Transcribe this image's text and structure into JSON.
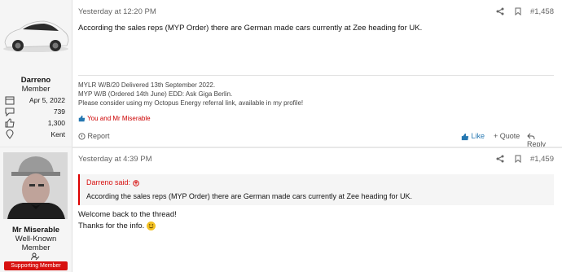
{
  "posts": [
    {
      "user": {
        "name": "Darreno",
        "title": "Member"
      },
      "stats": {
        "joined": "Apr 5, 2022",
        "messages": "739",
        "reactions": "1,300",
        "location": "Kent"
      },
      "time": "Yesterday at 12:20 PM",
      "number": "#1,458",
      "text": "According the sales reps (MYP Order) there are German made cars currently at Zee heading for UK.",
      "signature": [
        "MYLR W/B/20 Delivered 13th September 2022.",
        "MYP W/B (Ordered 14th June) EDD: Ask Giga Berlin.",
        "Please consider using my Octopus Energy referral link, available in my profile!"
      ],
      "likes": "You and Mr Miserable",
      "actions": {
        "report": "Report",
        "like": "Like",
        "quote": "+ Quote",
        "reply": "Reply"
      }
    },
    {
      "user": {
        "name": "Mr Miserable",
        "title_line1": "Well-Known",
        "title_line2": "Member",
        "badge": "Supporting Member"
      },
      "time": "Yesterday at 4:39 PM",
      "number": "#1,459",
      "quote": {
        "author": "Darreno said:",
        "text": "According the sales reps (MYP Order) there are German made cars currently at Zee heading for UK."
      },
      "line1": "Welcome back to the thread!",
      "line2": "Thanks for the info."
    }
  ],
  "colors": {
    "accent": "#d7100f",
    "link": "#2577b1"
  }
}
